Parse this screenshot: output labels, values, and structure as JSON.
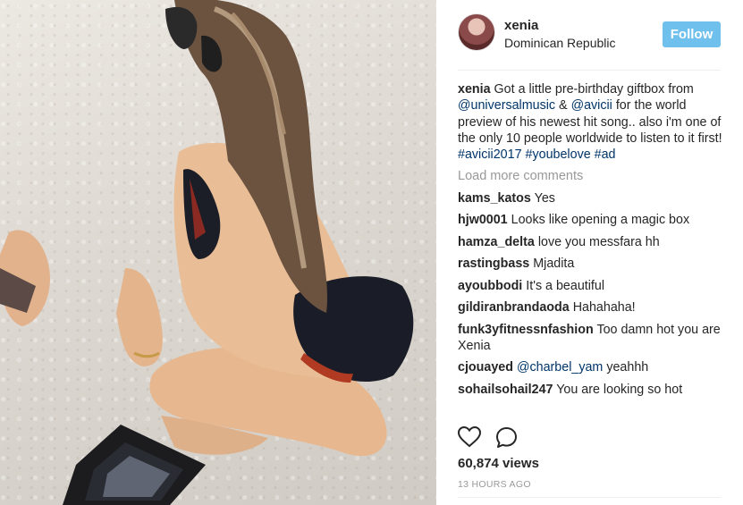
{
  "post": {
    "user": {
      "username": "xenia",
      "location": "Dominican Republic",
      "follow_label": "Follow"
    },
    "caption": {
      "username": "xenia",
      "text_1": "Got a little pre-birthday giftbox from ",
      "mention_1": "@universalmusic",
      "text_2": " & ",
      "mention_2": "@avicii",
      "text_3": " for the world preview of his newest hit song.. also i'm one of the only 10 people worldwide to listen to it first! ",
      "hashtag_1": "#avicii2017",
      "text_4": " ",
      "hashtag_2": "#youbelove",
      "text_5": " ",
      "hashtag_3": "#ad"
    },
    "load_more_label": "Load more comments",
    "comments": [
      {
        "user": "kams_katos",
        "text": "Yes"
      },
      {
        "user": "hjw0001",
        "text": "Looks like opening a magic box"
      },
      {
        "user": "hamza_delta",
        "text": "love you messfara hh"
      },
      {
        "user": "rastingbass",
        "text": "Mjadita"
      },
      {
        "user": "ayoubbodi",
        "text": "It's a beautiful"
      },
      {
        "user": "gildiranbrandaoda",
        "text": "Hahahaha!"
      },
      {
        "user": "funk3yfitnessnfashion",
        "text": "Too damn hot you are Xenia"
      },
      {
        "user": "cjouayed",
        "mention": "@charbel_yam",
        "text": "yeahhh"
      },
      {
        "user": "sohailsohail247",
        "text": "You are looking so hot"
      }
    ],
    "icons": {
      "like": "heart-icon",
      "comment": "comment-bubble-icon"
    },
    "views_label": "60,874 views",
    "timestamp": "13 HOURS AGO",
    "colors": {
      "follow_button": "#70c0ee",
      "link": "#003569",
      "muted": "#999999"
    }
  }
}
